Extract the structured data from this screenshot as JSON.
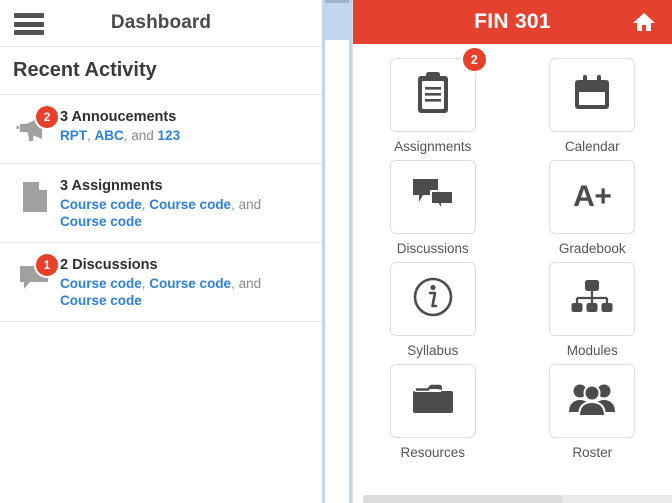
{
  "left_panel": {
    "menu_icon": "hamburger-menu-icon",
    "title": "Dashboard",
    "section_title": "Recent Activity",
    "activities": [
      {
        "icon": "megaphone-icon",
        "badge": "2",
        "title": "3 Annoucements",
        "links": [
          "RPT",
          "ABC",
          "123"
        ],
        "sep1": ", ",
        "sep2": ", and "
      },
      {
        "icon": "document-icon",
        "badge": "",
        "title": "3 Assignments",
        "links": [
          "Course code",
          "Course code",
          "Course code"
        ],
        "sep1": ", ",
        "sep2": ", and "
      },
      {
        "icon": "speech-bubble-icon",
        "badge": "1",
        "title": "2 Discussions",
        "links": [
          "Course code",
          "Course code",
          "Course code"
        ],
        "sep1": ", ",
        "sep2": ", and "
      }
    ]
  },
  "right_panel": {
    "course_title": "FIN 301",
    "home_icon": "home-icon",
    "header_color": "#e4412e",
    "badge_color": "#e8402a",
    "link_color": "#2f80d8",
    "tiles": [
      {
        "label": "Assignments",
        "icon": "clipboard-icon",
        "badge": "2"
      },
      {
        "label": "Calendar",
        "icon": "calendar-icon",
        "badge": ""
      },
      {
        "label": "Discussions",
        "icon": "speech-bubbles-icon",
        "badge": ""
      },
      {
        "label": "Gradebook",
        "icon": "grade-a-plus-icon",
        "badge": "",
        "text": "A+"
      },
      {
        "label": "Syllabus",
        "icon": "info-circle-icon",
        "badge": ""
      },
      {
        "label": "Modules",
        "icon": "hierarchy-icon",
        "badge": ""
      },
      {
        "label": "Resources",
        "icon": "folder-icon",
        "badge": ""
      },
      {
        "label": "Roster",
        "icon": "people-group-icon",
        "badge": ""
      }
    ]
  }
}
